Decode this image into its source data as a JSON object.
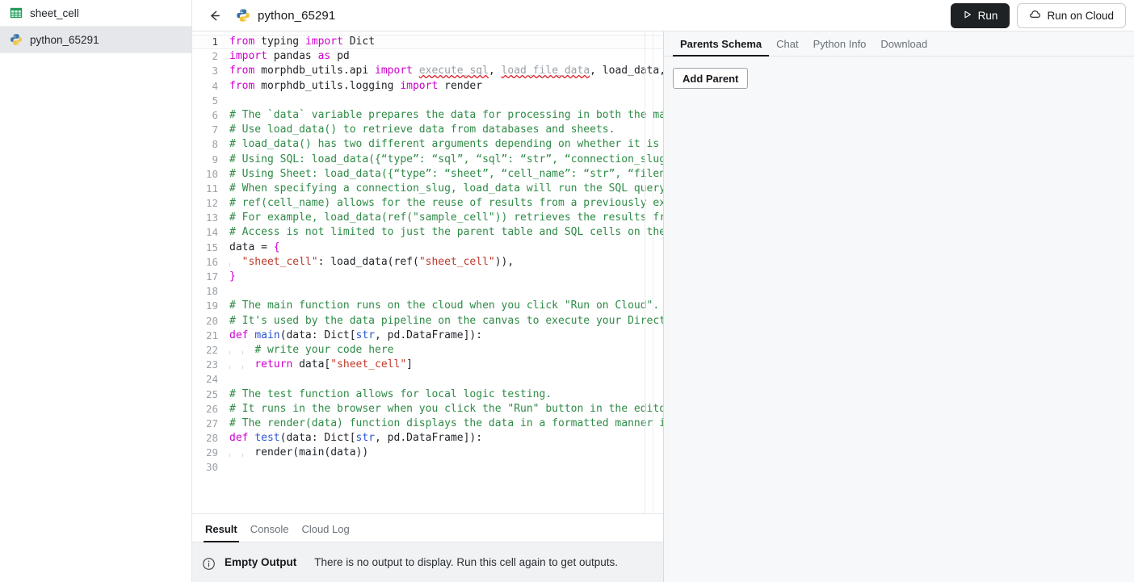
{
  "sidebar": {
    "items": [
      {
        "label": "sheet_cell",
        "icon": "spreadsheet-icon",
        "active": false
      },
      {
        "label": "python_65291",
        "icon": "python-icon",
        "active": true
      }
    ]
  },
  "topbar": {
    "back_icon": "arrow-left-icon",
    "title_icon": "python-icon",
    "title": "python_65291",
    "run_label": "Run",
    "run_icon": "play-triangle-icon",
    "run_cloud_label": "Run on Cloud",
    "run_cloud_icon": "cloud-icon"
  },
  "editor": {
    "ruler_column": 560,
    "active_line": 1,
    "lines": [
      {
        "n": 1,
        "html": "<span class='kw'>from</span> typing <span class='kw'>import</span> Dict"
      },
      {
        "n": 2,
        "html": "<span class='kw'>import</span> pandas <span class='kw'>as</span> pd"
      },
      {
        "n": 3,
        "html": "<span class='kw'>from</span> morphdb_utils.api <span class='kw'>import</span> <span class='sq'>execute_sql</span>, <span class='sq'>load_file_data</span>, load_data, <span class='errmark'>re</span>"
      },
      {
        "n": 4,
        "html": "<span class='kw'>from</span> morphdb_utils.logging <span class='kw'>import</span> render"
      },
      {
        "n": 5,
        "html": ""
      },
      {
        "n": 6,
        "html": "<span class='cm'># The `data` variable prepares the data for processing in both the main a</span>"
      },
      {
        "n": 7,
        "html": "<span class='cm'># Use load_data() to retrieve data from databases and sheets.</span>"
      },
      {
        "n": 8,
        "html": "<span class='cm'># load_data() has two different arguments depending on whether it is exec</span>"
      },
      {
        "n": 9,
        "html": "<span class='cm'># Using SQL: load_data({“type”: “sql”, “sql”: “str”, “connection_slug”: “</span>"
      },
      {
        "n": 10,
        "html": "<span class='cm'># Using Sheet: load_data({“type”: “sheet”, “cell_name”: “str”, “filename</span>"
      },
      {
        "n": 11,
        "html": "<span class='cm'># When specifying a connection_slug, load_data will run the SQL query on </span>"
      },
      {
        "n": 12,
        "html": "<span class='cm'># ref(cell_name) allows for the reuse of results from a previously execut</span>"
      },
      {
        "n": 13,
        "html": "<span class='cm'># For example, load_data(ref(\"sample_cell\")) retrieves the results from t</span>"
      },
      {
        "n": 14,
        "html": "<span class='cm'># Access is not limited to just the parent table and SQL cells on the can</span>"
      },
      {
        "n": 15,
        "html": "data = <span class='kw'>{</span>"
      },
      {
        "n": 16,
        "html": "<span class='ig'></span>  <span class='st'>\"sheet_cell\"</span>: load_data(ref(<span class='st'>\"sheet_cell\"</span>)),"
      },
      {
        "n": 17,
        "html": "<span class='kw'>}</span>"
      },
      {
        "n": 18,
        "html": ""
      },
      {
        "n": 19,
        "html": "<span class='cm'># The main function runs on the cloud when you click \"Run on Cloud\".</span>"
      },
      {
        "n": 20,
        "html": "<span class='cm'># It's used by the data pipeline on the canvas to execute your Directed A</span>"
      },
      {
        "n": 21,
        "html": "<span class='kw'>def</span> <span class='fn'>main</span>(data: Dict[<span class='ty'>str</span>, pd.DataFrame]):"
      },
      {
        "n": 22,
        "html": "<span class='ig'></span>  <span class='ig'></span>  <span class='cm'># write your code here</span>"
      },
      {
        "n": 23,
        "html": "<span class='ig'></span>  <span class='ig'></span>  <span class='kw'>return</span> data[<span class='st'>\"sheet_cell\"</span>]"
      },
      {
        "n": 24,
        "html": ""
      },
      {
        "n": 25,
        "html": "<span class='cm'># The test function allows for local logic testing.</span>"
      },
      {
        "n": 26,
        "html": "<span class='cm'># It runs in the browser when you click the \"Run\" button in the editor.</span>"
      },
      {
        "n": 27,
        "html": "<span class='cm'># The render(data) function displays the data in a formatted manner in th</span>"
      },
      {
        "n": 28,
        "html": "<span class='kw'>def</span> <span class='fn'>test</span>(data: Dict[<span class='ty'>str</span>, pd.DataFrame]):"
      },
      {
        "n": 29,
        "html": "<span class='ig'></span>  <span class='ig'></span>  render(main(data))"
      },
      {
        "n": 30,
        "html": ""
      }
    ]
  },
  "result": {
    "tabs": [
      {
        "label": "Result",
        "active": true
      },
      {
        "label": "Console",
        "active": false
      },
      {
        "label": "Cloud Log",
        "active": false
      }
    ],
    "icon": "info-circle-icon",
    "empty_title": "Empty Output",
    "empty_message": "There is no output to display. Run this cell again to get outputs."
  },
  "right_panel": {
    "tabs": [
      {
        "label": "Parents Schema",
        "active": true
      },
      {
        "label": "Chat",
        "active": false
      },
      {
        "label": "Python Info",
        "active": false
      },
      {
        "label": "Download",
        "active": false
      }
    ],
    "add_parent_label": "Add Parent"
  },
  "colors": {
    "run_button_bg": "#1f2225",
    "accent_text": "#15181c",
    "comment_green": "#2e8b46",
    "keyword_magenta": "#cf00cf",
    "string_red": "#c0392b",
    "function_blue": "#2a55d4",
    "error_marker": "#ff4d5e",
    "sidebar_active_bg": "#e5e7ea",
    "panel_bg": "#f7f8f9",
    "result_bg": "#f1f2f4"
  }
}
